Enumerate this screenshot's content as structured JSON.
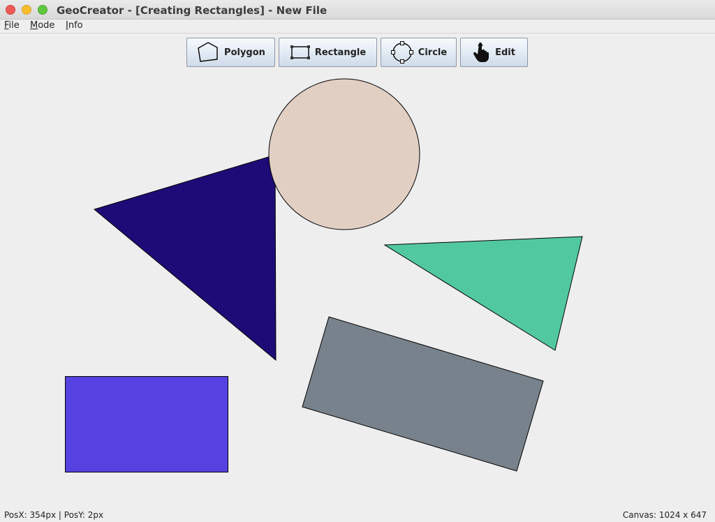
{
  "window": {
    "title": "GeoCreator - [Creating Rectangles] - New File"
  },
  "menu": {
    "file": "File",
    "mode": "Mode",
    "info": "Info"
  },
  "toolbar": {
    "polygon": {
      "label": "Polygon",
      "icon": "polygon-icon"
    },
    "rectangle": {
      "label": "Rectangle",
      "icon": "rectangle-icon"
    },
    "circle": {
      "label": "Circle",
      "icon": "circle-icon"
    },
    "edit": {
      "label": "Edit",
      "icon": "hand-pointer-icon"
    }
  },
  "shapes": {
    "circle": {
      "fill": "#e2cfc4",
      "stroke": "#000000"
    },
    "dark_triangle": {
      "fill": "#1f0b77",
      "stroke": "#000000"
    },
    "green_triangle": {
      "fill": "#52c8a0",
      "stroke": "#000000"
    },
    "gray_rectangle": {
      "fill": "#78828c",
      "stroke": "#000000"
    },
    "blue_rectangle": {
      "fill": "#5542e0",
      "stroke": "#000000"
    }
  },
  "status": {
    "position": "PosX: 354px | PosY: 2px",
    "canvas": "Canvas: 1024 x 647"
  },
  "colors": {
    "background": "#eeeeee",
    "button_border": "#8c98a8"
  }
}
